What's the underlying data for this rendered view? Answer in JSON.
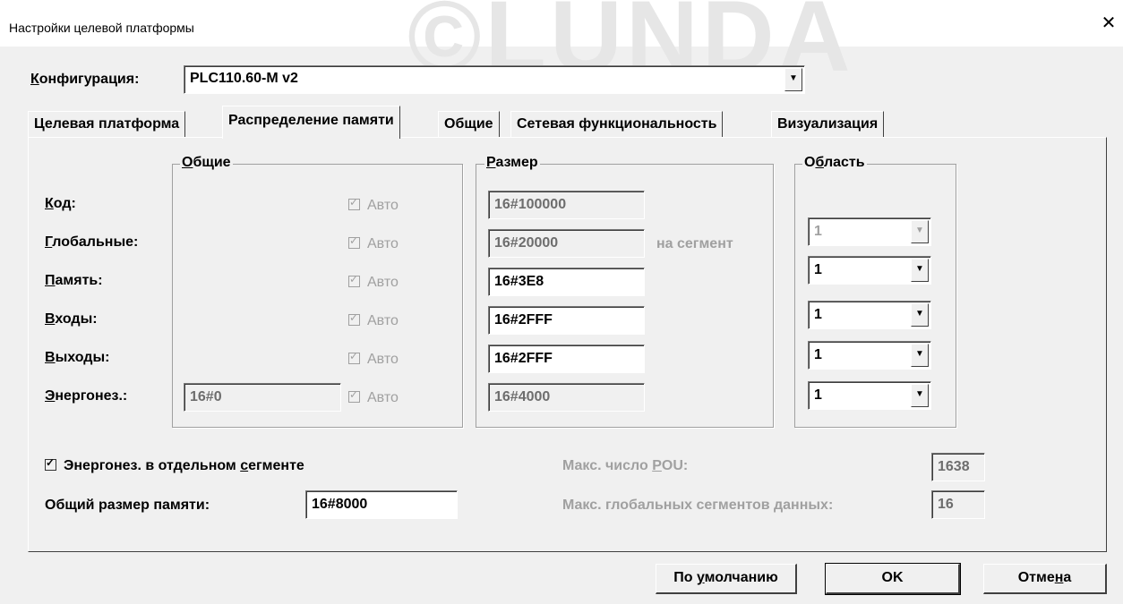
{
  "window": {
    "title": "Настройки целевой платформы",
    "close_glyph": "✕"
  },
  "watermark": "©LUNDA",
  "config": {
    "label_first": "К",
    "label_rest": "онфигурация:",
    "value": "PLC110.60-M v2"
  },
  "tabs": [
    {
      "label": "Целевая платформа",
      "active": false
    },
    {
      "label": "Распределение памяти",
      "active": true
    },
    {
      "label": "Общие",
      "active": false
    },
    {
      "label": "Сетевая функциональность",
      "active": false
    },
    {
      "label": "Визуализация",
      "active": false
    }
  ],
  "groups": {
    "general": {
      "first": "О",
      "rest": "бщие"
    },
    "size": {
      "first": "Р",
      "rest": "азмер"
    },
    "area": {
      "pre": "О",
      "ul": "б",
      "post": "ласть"
    }
  },
  "rows": [
    {
      "first": "К",
      "rest": "од:",
      "auto": "Авто",
      "size": "16#100000",
      "size_enabled": false,
      "area": null
    },
    {
      "first": "Г",
      "rest": "лобальные:",
      "auto": "Авто",
      "size": "16#20000",
      "size_enabled": false,
      "area": "1",
      "area_enabled": false
    },
    {
      "first": "П",
      "rest": "амять:",
      "auto": "Авто",
      "size": "16#3E8",
      "size_enabled": true,
      "area": "1",
      "area_enabled": true
    },
    {
      "first": "В",
      "rest": "ходы:",
      "auto": "Авто",
      "size": "16#2FFF",
      "size_enabled": true,
      "area": "1",
      "area_enabled": true
    },
    {
      "first": "В",
      "rest": "ыходы:",
      "auto": "Авто",
      "size": "16#2FFF",
      "size_enabled": true,
      "area": "1",
      "area_enabled": true
    },
    {
      "first": "Э",
      "rest": "нергонез.:",
      "auto": "Авто",
      "general": "16#0",
      "size": "16#4000",
      "size_enabled": false,
      "area": "1",
      "area_enabled": true
    }
  ],
  "per_segment": "на сегмент",
  "separate_segment": {
    "pre": "Энергонез. в отдельном ",
    "ul": "с",
    "post": "егменте",
    "checked": true
  },
  "total_memory": {
    "label": "Общий размер памяти:",
    "value": "16#8000"
  },
  "max_pou": {
    "pre": "Макс. число ",
    "ul": "P",
    "post": "OU:",
    "value": "1638"
  },
  "max_global": {
    "pre": "Макс. глобальных сегментов ",
    "ul": "д",
    "post": "анных:",
    "value": "16"
  },
  "buttons": {
    "default": {
      "pre": "По ",
      "ul": "у",
      "post": "молчанию"
    },
    "ok": "OK",
    "cancel": {
      "pre": "Отме",
      "ul": "н",
      "post": "а"
    }
  },
  "icons": {
    "checkbox": "checkbox-icon",
    "dropdown": "chevron-down-icon",
    "close": "close-icon"
  }
}
